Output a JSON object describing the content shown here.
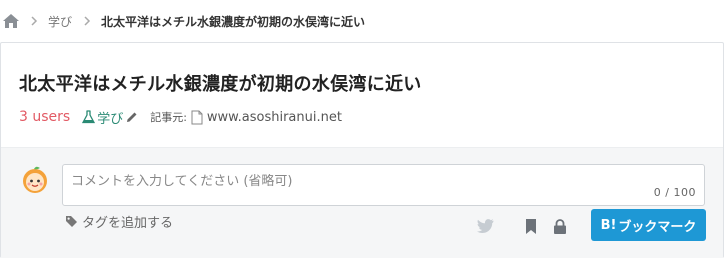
{
  "breadcrumb": {
    "home_icon": "home-icon",
    "category": "学び",
    "current": "北太平洋はメチル水銀濃度が初期の水俣湾に近い"
  },
  "entry": {
    "title": "北太平洋はメチル水銀濃度が初期の水俣湾に近い",
    "users": "3 users",
    "category": "学び",
    "source_label": "記事元:",
    "source_domain": "www.asoshiranui.net"
  },
  "comment": {
    "placeholder": "コメントを入力してください (省略可)",
    "char_count": "0 / 100",
    "add_tag": "タグを追加する"
  },
  "actions": {
    "bookmark_button": "ブックマーク",
    "bookmark_prefix": "B!"
  },
  "colors": {
    "users": "#e25a64",
    "category": "#2a8a74",
    "bookmark_button": "#1e98d5"
  }
}
